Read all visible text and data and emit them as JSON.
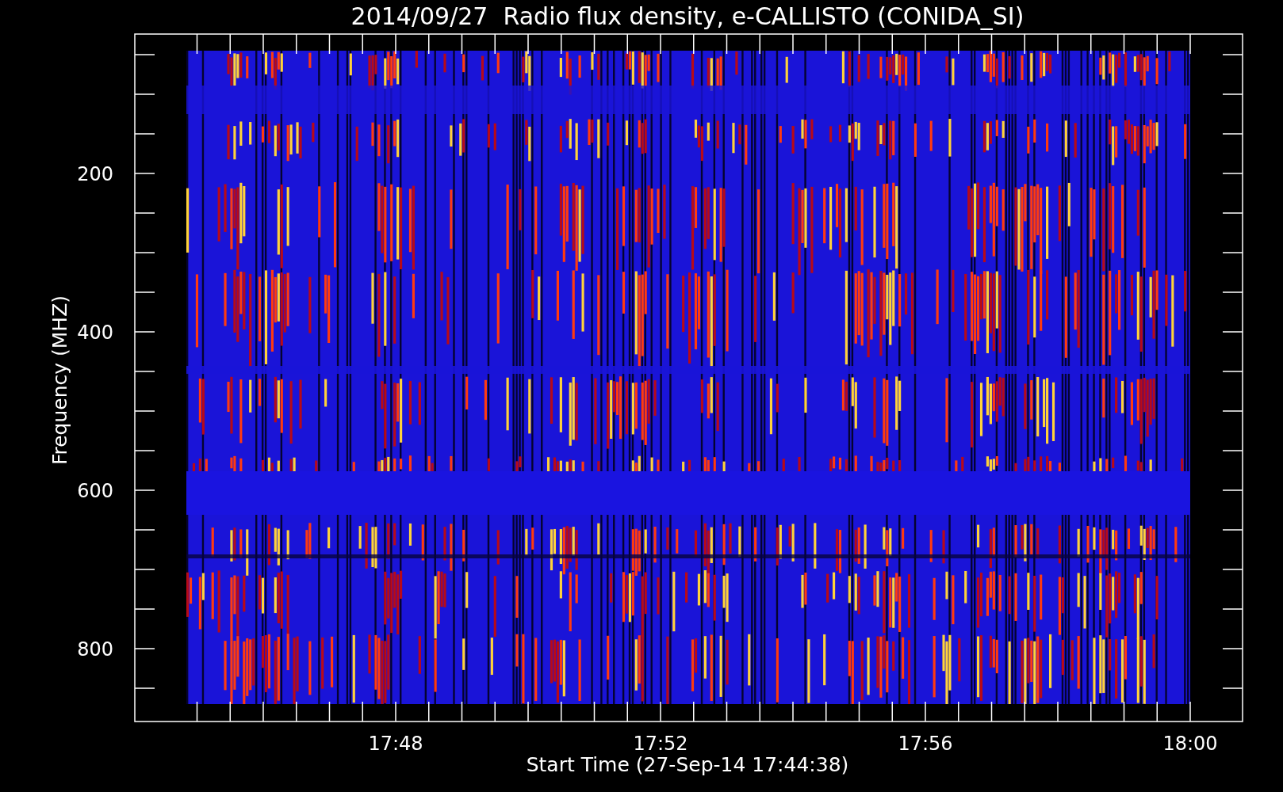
{
  "chart": {
    "title": "2014/09/27  Radio flux density, e-CALLISTO (CONIDA_SI)",
    "ylabel": "Frequency (MHZ)",
    "xlabel": "Start Time (27-Sep-14 17:44:38)",
    "yticks": [
      "200",
      "400",
      "600",
      "800"
    ],
    "xticks": [
      "17:48",
      "17:52",
      "17:56",
      "18:00"
    ]
  }
}
